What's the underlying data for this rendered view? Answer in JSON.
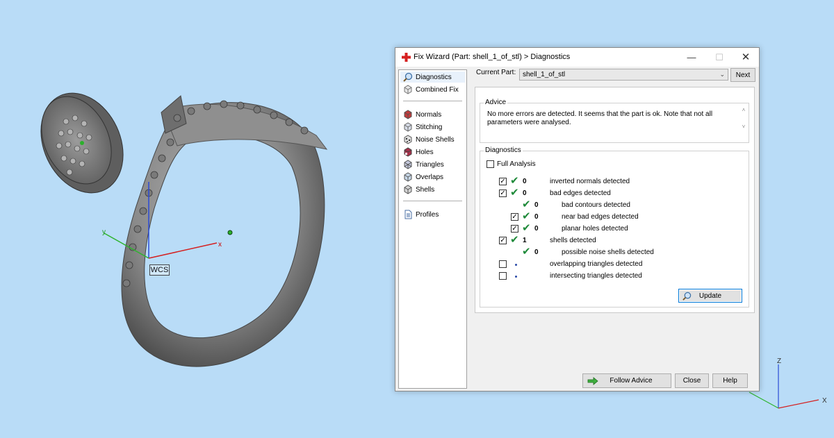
{
  "viewport": {
    "wcs_label": "WCS",
    "axis_x": "x",
    "axis_y": "y",
    "corner_axis_z": "Z",
    "corner_axis_x": "X"
  },
  "dialog": {
    "title": "Fix Wizard (Part: shell_1_of_stl) > Diagnostics",
    "current_part_label": "Current Part:",
    "current_part_value": "shell_1_of_stl",
    "next_label": "Next",
    "nav": {
      "items_top": [
        {
          "label": "Diagnostics",
          "icon": "magnifier-icon"
        },
        {
          "label": "Combined Fix",
          "icon": "cube-icon"
        }
      ],
      "items_mid": [
        {
          "label": "Normals",
          "icon": "normals-cube-icon"
        },
        {
          "label": "Stitching",
          "icon": "stitching-cube-icon"
        },
        {
          "label": "Noise Shells",
          "icon": "noise-shells-icon"
        },
        {
          "label": "Holes",
          "icon": "holes-cube-icon"
        },
        {
          "label": "Triangles",
          "icon": "triangles-cube-icon"
        },
        {
          "label": "Overlaps",
          "icon": "overlaps-cube-icon"
        },
        {
          "label": "Shells",
          "icon": "shells-cube-icon"
        }
      ],
      "items_bottom": [
        {
          "label": "Profiles",
          "icon": "document-icon"
        }
      ]
    },
    "advice": {
      "title": "Advice",
      "text": "No more errors are detected. It seems that the part is ok. Note that not all parameters were analysed."
    },
    "diagnostics": {
      "title": "Diagnostics",
      "full_analysis_label": "Full Analysis",
      "full_analysis_checked": false,
      "rows": [
        {
          "checked": true,
          "status": "ok",
          "count": "0",
          "label": "inverted normals detected"
        },
        {
          "checked": true,
          "status": "ok",
          "count": "0",
          "label": "bad edges detected"
        },
        {
          "checked": null,
          "status": "ok",
          "count": "0",
          "label": "bad contours detected"
        },
        {
          "checked": true,
          "status": "ok",
          "count": "0",
          "label": "near bad edges detected"
        },
        {
          "checked": true,
          "status": "ok",
          "count": "0",
          "label": "planar holes detected"
        },
        {
          "checked": true,
          "status": "ok",
          "count": "1",
          "label": "shells detected"
        },
        {
          "checked": null,
          "status": "ok",
          "count": "0",
          "label": "possible noise shells detected"
        },
        {
          "checked": false,
          "status": "unknown",
          "count": "",
          "label": "overlapping triangles detected"
        },
        {
          "checked": false,
          "status": "unknown",
          "count": "",
          "label": "intersecting triangles detected"
        }
      ],
      "update_label": "Update"
    },
    "footer": {
      "follow_advice_label": "Follow Advice",
      "close_label": "Close",
      "help_label": "Help"
    },
    "colors": {
      "ok_tick": "#1f8a3a",
      "accent": "#0078d7",
      "viewport_bg": "#b9dcf7"
    }
  }
}
